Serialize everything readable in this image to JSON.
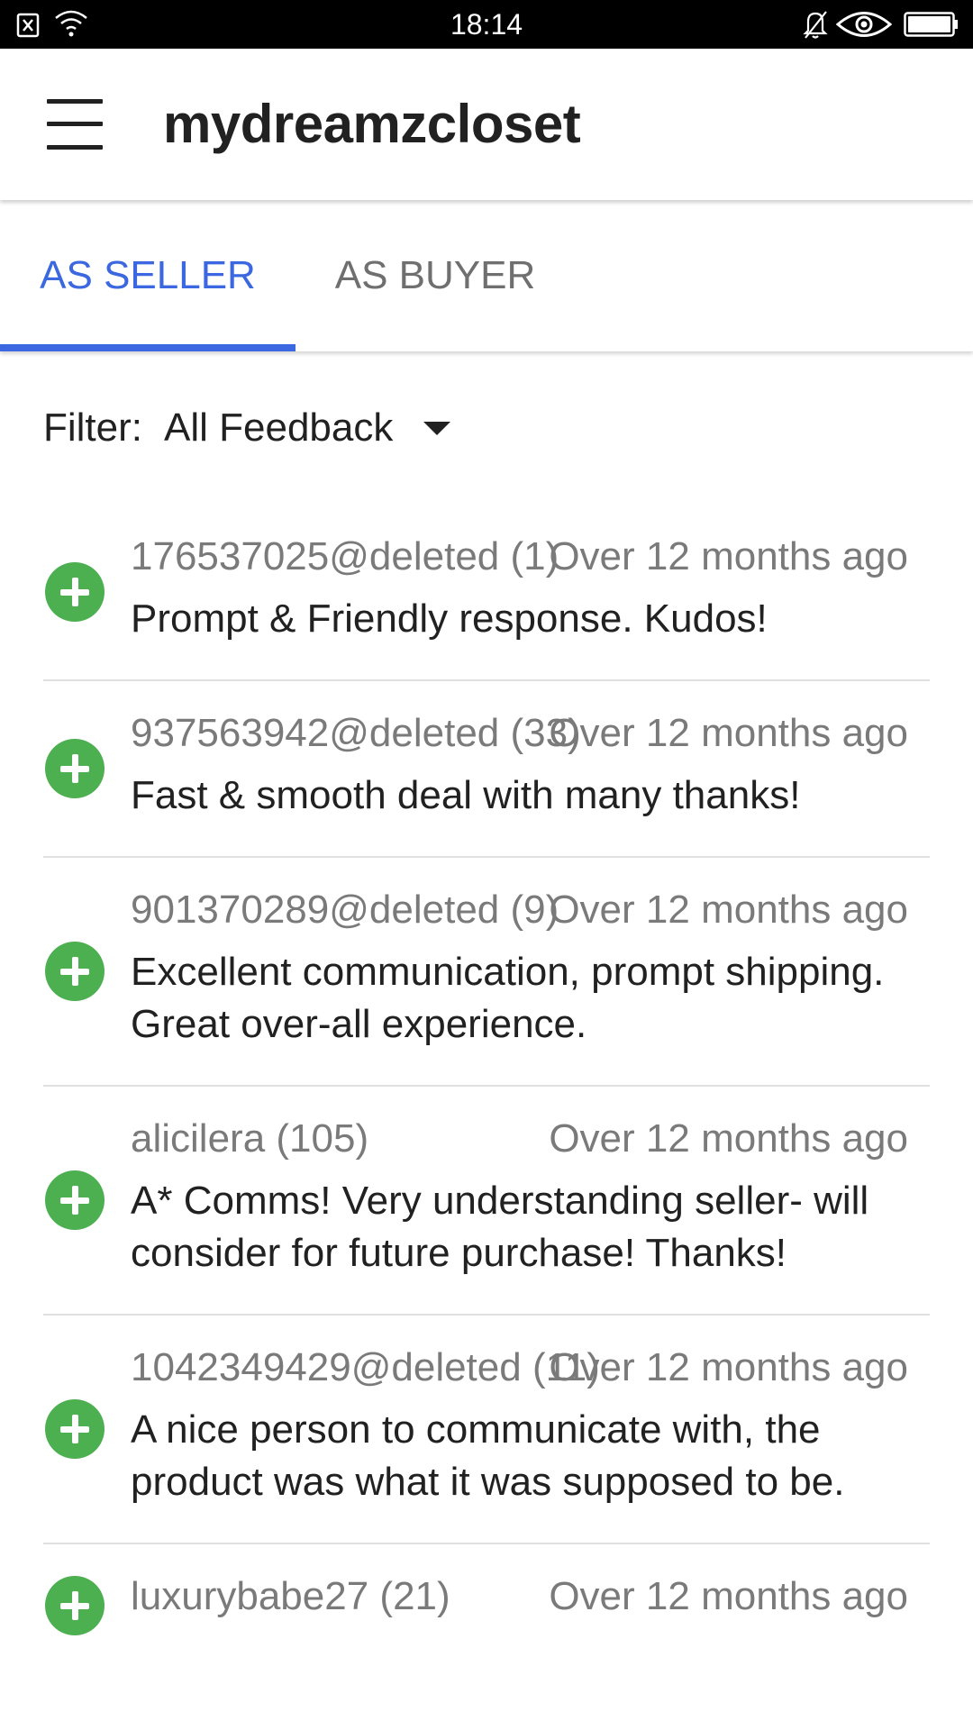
{
  "status_bar": {
    "time": "18:14",
    "icons": [
      "sim-card-icon",
      "wifi-icon",
      "bell-off-icon",
      "eye-icon",
      "battery-icon"
    ]
  },
  "app_bar": {
    "menu_icon": "hamburger-menu-icon",
    "title": "mydreamzcloset"
  },
  "tabs": [
    {
      "label": "AS SELLER",
      "active": true
    },
    {
      "label": "AS BUYER",
      "active": false
    }
  ],
  "filter": {
    "label": "Filter:",
    "value": "All Feedback"
  },
  "colors": {
    "accent": "#3b67e0",
    "positive": "#4caf50",
    "secondary_text": "#7a7a7a",
    "divider": "#e0e0e0"
  },
  "feedback": [
    {
      "user": "176537025@deleted (1)",
      "time": "Over 12 months ago",
      "comment": "Prompt & Friendly response. Kudos!",
      "rating_icon": "positive-plus-icon"
    },
    {
      "user": "937563942@deleted (33)",
      "time": "Over 12 months ago",
      "comment": "Fast & smooth deal with many thanks!",
      "rating_icon": "positive-plus-icon"
    },
    {
      "user": "901370289@deleted (9)",
      "time": "Over 12 months ago",
      "comment": "Excellent communication, prompt shipping. Great over-all experience.",
      "rating_icon": "positive-plus-icon"
    },
    {
      "user": "alicilera (105)",
      "time": "Over 12 months ago",
      "comment": "A* Comms! Very understanding seller- will consider for future purchase! Thanks!",
      "rating_icon": "positive-plus-icon"
    },
    {
      "user": "1042349429@deleted (11)",
      "time": "Over 12 months ago",
      "comment": "A nice person to communicate with, the product was what it was supposed to be.",
      "rating_icon": "positive-plus-icon"
    },
    {
      "user": "luxurybabe27 (21)",
      "time": "Over 12 months ago",
      "comment": "",
      "rating_icon": "positive-plus-icon"
    }
  ]
}
